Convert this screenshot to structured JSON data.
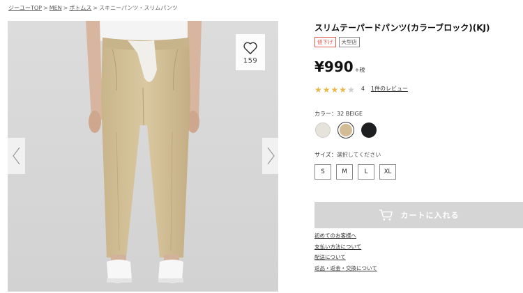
{
  "breadcrumb": [
    {
      "label": "ジーユーTOP",
      "link": true
    },
    {
      "label": "MEN",
      "link": true
    },
    {
      "label": "ボトムス",
      "link": true
    },
    {
      "label": "スキニーパンツ・スリムパンツ",
      "link": false
    }
  ],
  "breadcrumb_separator": ">",
  "favorite": {
    "count": "159",
    "icon": "heart-icon"
  },
  "product": {
    "title": "スリムテーパードパンツ(カラーブロック)(KJ)",
    "badges": [
      "値下げ",
      "大型店"
    ],
    "price": "¥990",
    "tax": "+税"
  },
  "rating": {
    "stars_filled": 4,
    "stars_total": 5,
    "score": "4",
    "review_link": "1件のレビュー"
  },
  "color": {
    "label": "カラー：32 BEIGE",
    "swatches": [
      {
        "name": "off-white",
        "hex": "#e6e3dd",
        "selected": false
      },
      {
        "name": "beige",
        "hex": "#d2bd96",
        "selected": true
      },
      {
        "name": "black",
        "hex": "#1e1f21",
        "selected": false
      }
    ]
  },
  "size": {
    "label_prefix": "サイズ：",
    "label_hint": "選択してください",
    "options": [
      "S",
      "M",
      "L",
      "XL"
    ]
  },
  "cart": {
    "label": "カートに入れる",
    "icon": "cart-icon"
  },
  "links": [
    "初めてのお客様へ",
    "支払い方法について",
    "配送について",
    "返品・返金・交換について"
  ],
  "colors": {
    "cart_bg": "#d5d5d5",
    "sale_badge": "#e05a4e",
    "star": "#e9b84a",
    "gallery_bg": "#d9d9d9"
  }
}
